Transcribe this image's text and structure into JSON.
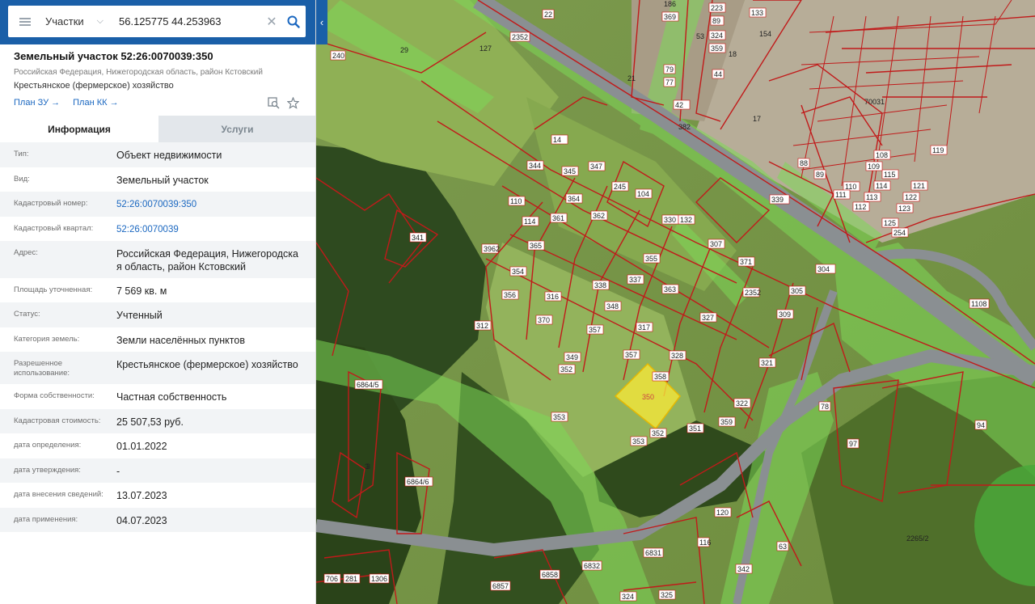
{
  "search": {
    "layer": "Участки",
    "query": "56.125775 44.253963"
  },
  "card": {
    "title": "Земельный участок 52:26:0070039:350",
    "region": "Российская Федерация, Нижегородская область, район Кстовский",
    "use": "Крестьянское (фермерское) хозяйство",
    "links": [
      "План ЗУ →",
      "План КК →"
    ]
  },
  "tabs": [
    "Информация",
    "Услуги"
  ],
  "info": [
    {
      "label": "Тип:",
      "value": "Объект недвижимости"
    },
    {
      "label": "Вид:",
      "value": "Земельный участок"
    },
    {
      "label": "Кадастровый номер:",
      "value": "52:26:0070039:350"
    },
    {
      "label": "Кадастровый квартал:",
      "value": "52:26:0070039"
    },
    {
      "label": "Адрес:",
      "value": "Российская Федерация, Нижегородска я область, район Кстовский"
    },
    {
      "label": "Площадь уточненная:",
      "value": "7 569 кв. м"
    },
    {
      "label": "Статус:",
      "value": "Учтенный"
    },
    {
      "label": "Категория земель:",
      "value": "Земли населённых пунктов"
    },
    {
      "label": "Разрешенное использование:",
      "value": "Крестьянское (фермерское) хозяйство"
    },
    {
      "label": "Форма собственности:",
      "value": "Частная собственность"
    },
    {
      "label": "Кадастровая стоимость:",
      "value": "25 507,53 руб."
    },
    {
      "label": "дата определения:",
      "value": "01.01.2022"
    },
    {
      "label": "дата утверждения:",
      "value": "-"
    },
    {
      "label": "дата внесения сведений:",
      "value": "13.07.2023"
    },
    {
      "label": "дата применения:",
      "value": "04.07.2023"
    }
  ],
  "map_labels": {
    "selected": "350",
    "parcels": [
      "22",
      "2352",
      "29",
      "127",
      "240",
      "186",
      "369",
      "89",
      "324",
      "359",
      "133",
      "223",
      "79",
      "77",
      "44",
      "53",
      "18",
      "154",
      "17",
      "21",
      "42",
      "382",
      "14",
      "344",
      "345",
      "347",
      "245",
      "104",
      "110",
      "364",
      "361",
      "362",
      "330",
      "132",
      "307",
      "114",
      "365",
      "363",
      "339",
      "3962",
      "354",
      "355",
      "337",
      "338",
      "316",
      "356",
      "371",
      "304",
      "2352",
      "305",
      "309",
      "312",
      "370",
      "348",
      "327",
      "357",
      "317",
      "349",
      "357",
      "328",
      "321",
      "352",
      "358",
      "322",
      "78",
      "94",
      "353",
      "351",
      "359",
      "353",
      "352",
      "97",
      "3",
      "120",
      "6831",
      "116",
      "6832",
      "6857",
      "6858",
      "325",
      "324",
      "342",
      "63",
      "2265/2",
      "1108",
      "341",
      "3",
      "6864/5",
      "6864/6",
      "70031",
      "706",
      "281",
      "1306",
      "88",
      "89",
      "110",
      "111",
      "112",
      "113",
      "114",
      "115",
      "108",
      "109",
      "125",
      "254",
      "123",
      "122",
      "121",
      "119"
    ]
  },
  "colors": {
    "header": "#1a5fa8",
    "link": "#1a67c0",
    "parcel_border": "#c11a1a",
    "zone": "#7ed957",
    "selected": "#f5e63a"
  }
}
